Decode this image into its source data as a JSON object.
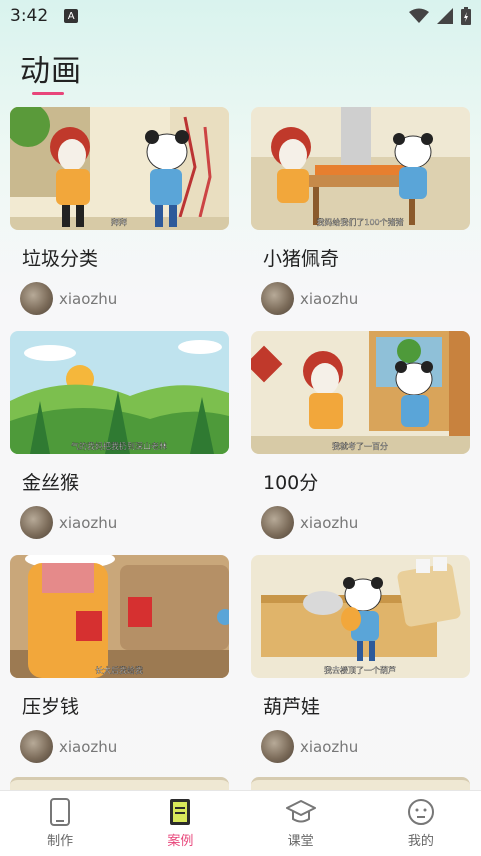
{
  "status_bar": {
    "time": "3:42",
    "notification_badge": "A"
  },
  "page": {
    "title": "动画"
  },
  "colors": {
    "accent": "#e8457a",
    "icon_active": "#2b2b2b"
  },
  "cards": [
    {
      "title": "垃圾分类",
      "author": "xiaozhu",
      "subtitle": "拜拜"
    },
    {
      "title": "小猪佩奇",
      "author": "xiaozhu",
      "subtitle": "我妈给我们了100个猪猪"
    },
    {
      "title": "金丝猴",
      "author": "xiaozhu",
      "subtitle": "气的我妈把我扔到深山老林"
    },
    {
      "title": "100分",
      "author": "xiaozhu",
      "subtitle": "我就考了一百分"
    },
    {
      "title": "压岁钱",
      "author": "xiaozhu",
      "subtitle": "长大后我给我"
    },
    {
      "title": "葫芦娃",
      "author": "xiaozhu",
      "subtitle": "我去楼顶了一个葫芦"
    }
  ],
  "tabs": [
    {
      "label": "制作",
      "icon": "phone-icon",
      "active": false
    },
    {
      "label": "案例",
      "icon": "document-icon",
      "active": true
    },
    {
      "label": "课堂",
      "icon": "graduation-cap-icon",
      "active": false
    },
    {
      "label": "我的",
      "icon": "face-icon",
      "active": false
    }
  ]
}
